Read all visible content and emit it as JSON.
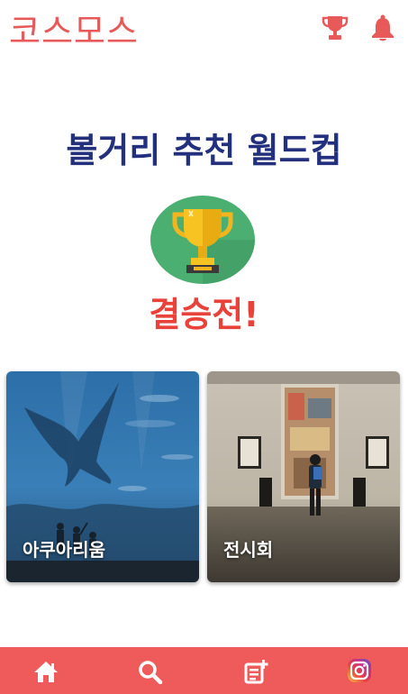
{
  "header": {
    "logo": "코스모스",
    "trophy_icon": "trophy-icon",
    "bell_icon": "bell-icon"
  },
  "main": {
    "title": "볼거리 추천 월드컵",
    "round_label": "결승전!",
    "badge_icon": "trophy-icon"
  },
  "cards": [
    {
      "label": "아쿠아리움"
    },
    {
      "label": "전시회"
    }
  ],
  "bottom_nav": [
    {
      "icon": "home-icon"
    },
    {
      "icon": "search-icon"
    },
    {
      "icon": "add-post-icon"
    },
    {
      "icon": "instagram-icon"
    }
  ],
  "colors": {
    "brand": "#e85a5a",
    "title": "#23307e",
    "round": "#e8423b",
    "nav_bar": "#ef5b5b"
  }
}
